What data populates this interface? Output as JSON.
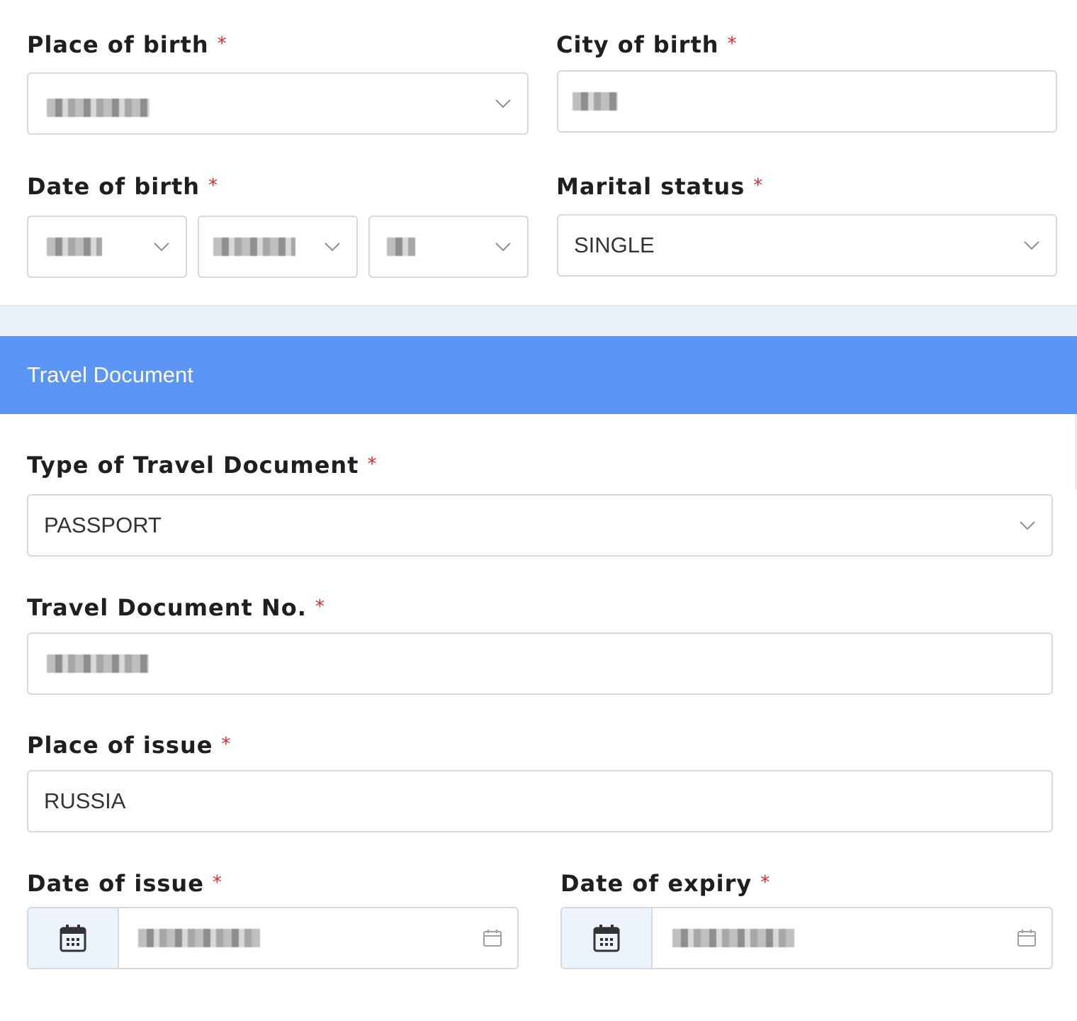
{
  "required_mark": "*",
  "place_of_birth": {
    "label": "Place of birth"
  },
  "city_of_birth": {
    "label": "City of birth"
  },
  "date_of_birth": {
    "label": "Date of birth"
  },
  "marital_status": {
    "label": "Marital status",
    "value": "SINGLE"
  },
  "travel_document": {
    "section_title": "Travel Document",
    "type": {
      "label": "Type of Travel Document",
      "value": "PASSPORT"
    },
    "number": {
      "label": "Travel Document No."
    },
    "place_of_issue": {
      "label": "Place of issue",
      "value": "RUSSIA"
    },
    "date_of_issue": {
      "label": "Date of issue"
    },
    "date_of_expiry": {
      "label": "Date of expiry"
    }
  },
  "colors": {
    "section_bar": "#5b96f7",
    "required": "#e0282e",
    "border": "#d6d9de",
    "addon_bg": "#edf3fd"
  },
  "icons": [
    "chevron-down-icon",
    "calendar-icon"
  ]
}
